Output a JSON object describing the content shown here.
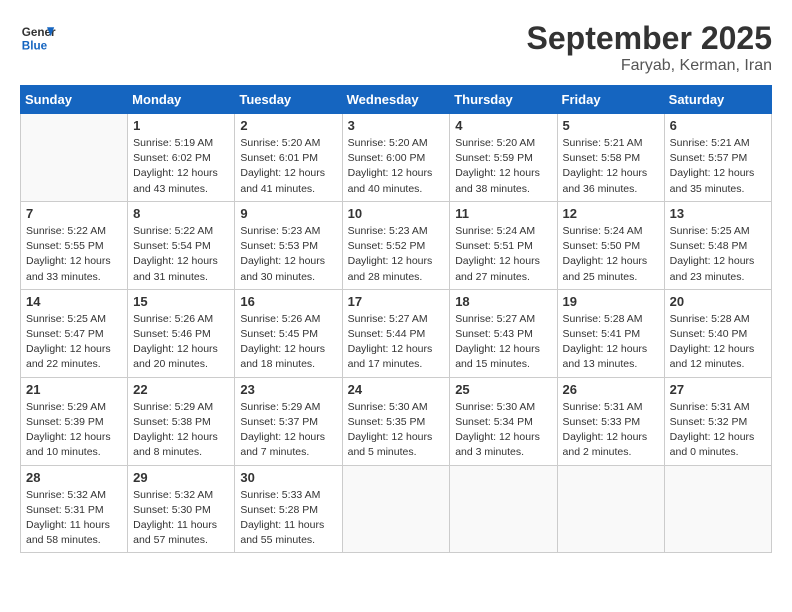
{
  "header": {
    "logo_line1": "General",
    "logo_line2": "Blue",
    "month_title": "September 2025",
    "location": "Faryab, Kerman, Iran"
  },
  "days_of_week": [
    "Sunday",
    "Monday",
    "Tuesday",
    "Wednesday",
    "Thursday",
    "Friday",
    "Saturday"
  ],
  "weeks": [
    [
      {
        "day": "",
        "info": ""
      },
      {
        "day": "1",
        "info": "Sunrise: 5:19 AM\nSunset: 6:02 PM\nDaylight: 12 hours\nand 43 minutes."
      },
      {
        "day": "2",
        "info": "Sunrise: 5:20 AM\nSunset: 6:01 PM\nDaylight: 12 hours\nand 41 minutes."
      },
      {
        "day": "3",
        "info": "Sunrise: 5:20 AM\nSunset: 6:00 PM\nDaylight: 12 hours\nand 40 minutes."
      },
      {
        "day": "4",
        "info": "Sunrise: 5:20 AM\nSunset: 5:59 PM\nDaylight: 12 hours\nand 38 minutes."
      },
      {
        "day": "5",
        "info": "Sunrise: 5:21 AM\nSunset: 5:58 PM\nDaylight: 12 hours\nand 36 minutes."
      },
      {
        "day": "6",
        "info": "Sunrise: 5:21 AM\nSunset: 5:57 PM\nDaylight: 12 hours\nand 35 minutes."
      }
    ],
    [
      {
        "day": "7",
        "info": "Sunrise: 5:22 AM\nSunset: 5:55 PM\nDaylight: 12 hours\nand 33 minutes."
      },
      {
        "day": "8",
        "info": "Sunrise: 5:22 AM\nSunset: 5:54 PM\nDaylight: 12 hours\nand 31 minutes."
      },
      {
        "day": "9",
        "info": "Sunrise: 5:23 AM\nSunset: 5:53 PM\nDaylight: 12 hours\nand 30 minutes."
      },
      {
        "day": "10",
        "info": "Sunrise: 5:23 AM\nSunset: 5:52 PM\nDaylight: 12 hours\nand 28 minutes."
      },
      {
        "day": "11",
        "info": "Sunrise: 5:24 AM\nSunset: 5:51 PM\nDaylight: 12 hours\nand 27 minutes."
      },
      {
        "day": "12",
        "info": "Sunrise: 5:24 AM\nSunset: 5:50 PM\nDaylight: 12 hours\nand 25 minutes."
      },
      {
        "day": "13",
        "info": "Sunrise: 5:25 AM\nSunset: 5:48 PM\nDaylight: 12 hours\nand 23 minutes."
      }
    ],
    [
      {
        "day": "14",
        "info": "Sunrise: 5:25 AM\nSunset: 5:47 PM\nDaylight: 12 hours\nand 22 minutes."
      },
      {
        "day": "15",
        "info": "Sunrise: 5:26 AM\nSunset: 5:46 PM\nDaylight: 12 hours\nand 20 minutes."
      },
      {
        "day": "16",
        "info": "Sunrise: 5:26 AM\nSunset: 5:45 PM\nDaylight: 12 hours\nand 18 minutes."
      },
      {
        "day": "17",
        "info": "Sunrise: 5:27 AM\nSunset: 5:44 PM\nDaylight: 12 hours\nand 17 minutes."
      },
      {
        "day": "18",
        "info": "Sunrise: 5:27 AM\nSunset: 5:43 PM\nDaylight: 12 hours\nand 15 minutes."
      },
      {
        "day": "19",
        "info": "Sunrise: 5:28 AM\nSunset: 5:41 PM\nDaylight: 12 hours\nand 13 minutes."
      },
      {
        "day": "20",
        "info": "Sunrise: 5:28 AM\nSunset: 5:40 PM\nDaylight: 12 hours\nand 12 minutes."
      }
    ],
    [
      {
        "day": "21",
        "info": "Sunrise: 5:29 AM\nSunset: 5:39 PM\nDaylight: 12 hours\nand 10 minutes."
      },
      {
        "day": "22",
        "info": "Sunrise: 5:29 AM\nSunset: 5:38 PM\nDaylight: 12 hours\nand 8 minutes."
      },
      {
        "day": "23",
        "info": "Sunrise: 5:29 AM\nSunset: 5:37 PM\nDaylight: 12 hours\nand 7 minutes."
      },
      {
        "day": "24",
        "info": "Sunrise: 5:30 AM\nSunset: 5:35 PM\nDaylight: 12 hours\nand 5 minutes."
      },
      {
        "day": "25",
        "info": "Sunrise: 5:30 AM\nSunset: 5:34 PM\nDaylight: 12 hours\nand 3 minutes."
      },
      {
        "day": "26",
        "info": "Sunrise: 5:31 AM\nSunset: 5:33 PM\nDaylight: 12 hours\nand 2 minutes."
      },
      {
        "day": "27",
        "info": "Sunrise: 5:31 AM\nSunset: 5:32 PM\nDaylight: 12 hours\nand 0 minutes."
      }
    ],
    [
      {
        "day": "28",
        "info": "Sunrise: 5:32 AM\nSunset: 5:31 PM\nDaylight: 11 hours\nand 58 minutes."
      },
      {
        "day": "29",
        "info": "Sunrise: 5:32 AM\nSunset: 5:30 PM\nDaylight: 11 hours\nand 57 minutes."
      },
      {
        "day": "30",
        "info": "Sunrise: 5:33 AM\nSunset: 5:28 PM\nDaylight: 11 hours\nand 55 minutes."
      },
      {
        "day": "",
        "info": ""
      },
      {
        "day": "",
        "info": ""
      },
      {
        "day": "",
        "info": ""
      },
      {
        "day": "",
        "info": ""
      }
    ]
  ]
}
